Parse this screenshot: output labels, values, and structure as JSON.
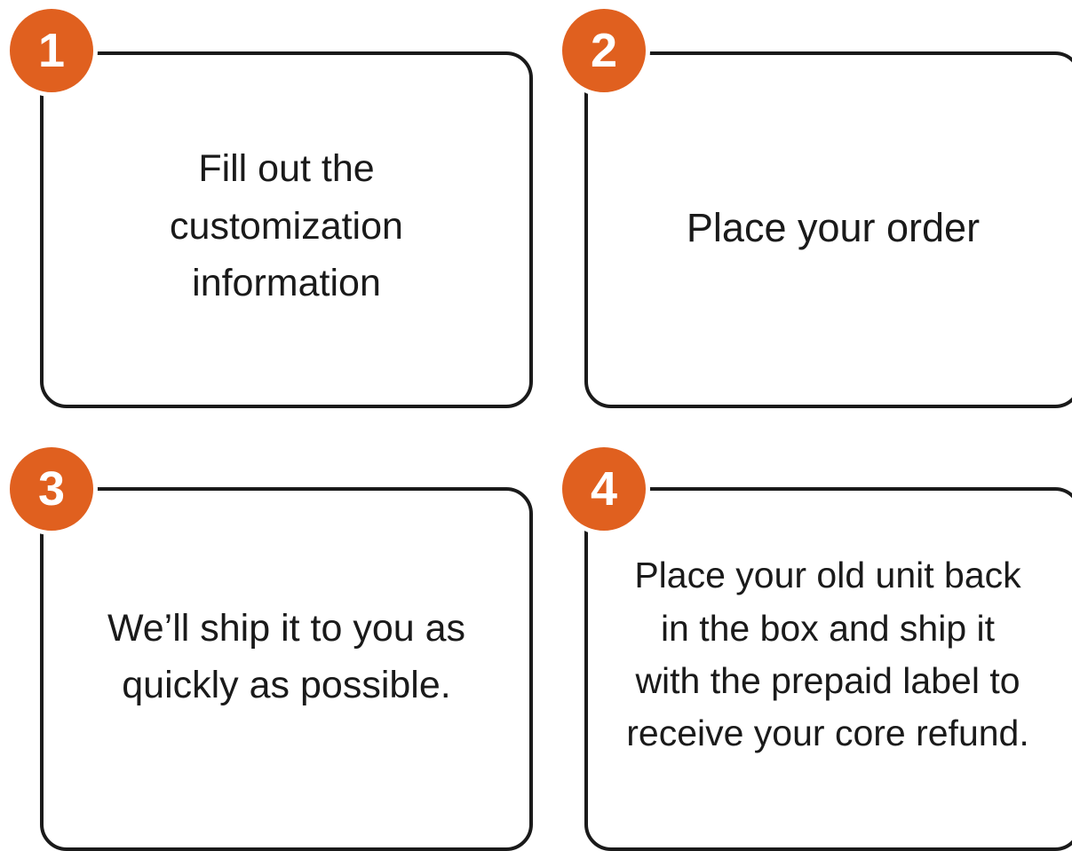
{
  "accent_color": "#e0601f",
  "steps": [
    {
      "number": "1",
      "text": "Fill out the\ncustomization\ninformation"
    },
    {
      "number": "2",
      "text": "Place your order"
    },
    {
      "number": "3",
      "text": "We’ll ship it to you as\nquickly as possible."
    },
    {
      "number": "4",
      "text": "Place your old unit back\nin the box and ship it\nwith the prepaid label to\nreceive your core refund."
    }
  ]
}
